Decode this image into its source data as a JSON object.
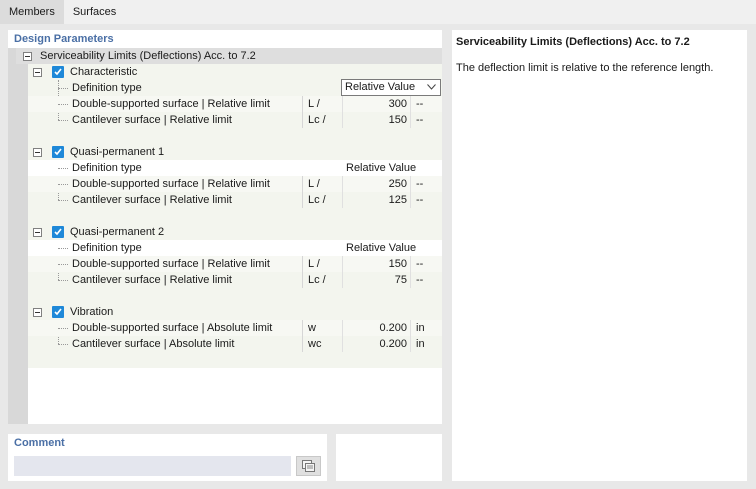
{
  "tabs": [
    {
      "label": "Members",
      "active": true
    },
    {
      "label": "Surfaces",
      "active": false
    }
  ],
  "params": {
    "title": "Design Parameters",
    "root_label": "Serviceability Limits (Deflections) Acc. to 7.2",
    "sections": [
      {
        "label": "Characteristic",
        "checked": true,
        "def_label": "Definition type",
        "def_value": "Relative Value",
        "rows": [
          {
            "name": "Double-supported surface | Relative limit",
            "sym": "L /",
            "val": "300",
            "unit": "--"
          },
          {
            "name": "Cantilever surface | Relative limit",
            "sym": "Lc /",
            "val": "150",
            "unit": "--"
          }
        ]
      },
      {
        "label": "Quasi-permanent 1",
        "checked": true,
        "def_label": "Definition type",
        "def_value": "Relative Value",
        "rows": [
          {
            "name": "Double-supported surface | Relative limit",
            "sym": "L /",
            "val": "250",
            "unit": "--"
          },
          {
            "name": "Cantilever surface | Relative limit",
            "sym": "Lc /",
            "val": "125",
            "unit": "--"
          }
        ]
      },
      {
        "label": "Quasi-permanent 2",
        "checked": true,
        "def_label": "Definition type",
        "def_value": "Relative Value",
        "rows": [
          {
            "name": "Double-supported surface | Relative limit",
            "sym": "L /",
            "val": "150",
            "unit": "--"
          },
          {
            "name": "Cantilever surface | Relative limit",
            "sym": "Lc /",
            "val": "75",
            "unit": "--"
          }
        ]
      },
      {
        "label": "Vibration",
        "checked": true,
        "rows": [
          {
            "name": "Double-supported surface | Absolute limit",
            "sym": "w",
            "val": "0.200",
            "unit": "in"
          },
          {
            "name": "Cantilever surface | Absolute limit",
            "sym": "wc",
            "val": "0.200",
            "unit": "in"
          }
        ]
      }
    ]
  },
  "info": {
    "title": "Serviceability Limits (Deflections) Acc. to 7.2",
    "text": "The deflection limit is relative to the reference length."
  },
  "comment": {
    "title": "Comment",
    "value": ""
  },
  "colors": {
    "accent": "#1e88d8",
    "panel_title": "#4a6fa5"
  }
}
